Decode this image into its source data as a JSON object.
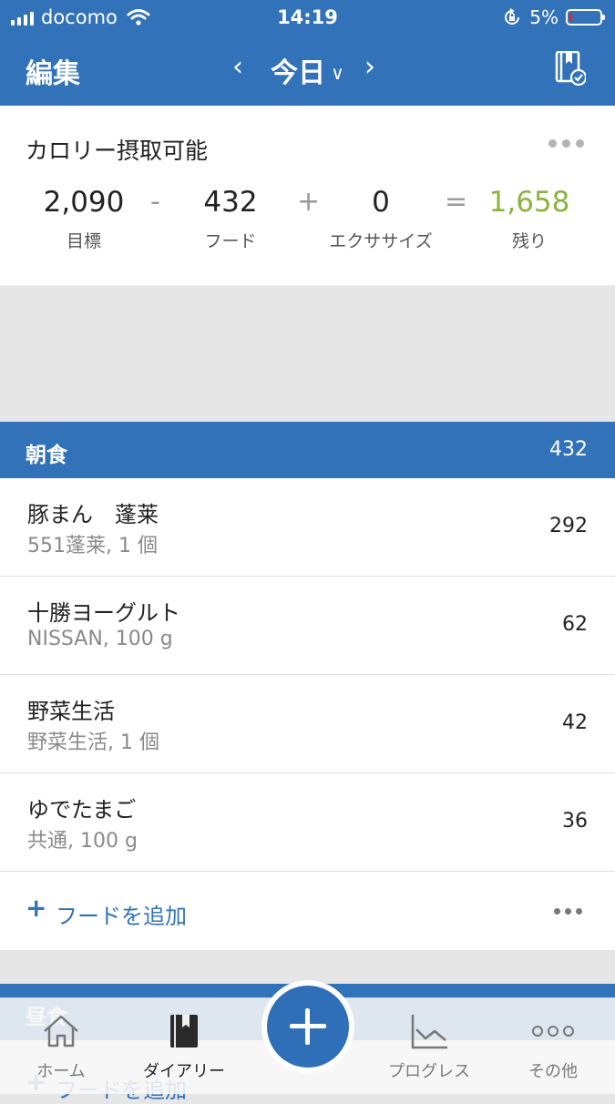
{
  "status_bar": {
    "carrier": "docomo",
    "time": "14:19",
    "battery": "5%"
  },
  "nav": {
    "edit_label": "編集",
    "date_label": "今日",
    "prev": "‹",
    "next": "›",
    "chevron": "∨"
  },
  "calories": {
    "title": "カロリー摂取可能",
    "goal_value": "2,090",
    "goal_label": "目標",
    "minus": "-",
    "food_value": "432",
    "food_label": "フード",
    "plus": "+",
    "exercise_value": "0",
    "exercise_label": "エクササイズ",
    "equals": "=",
    "remaining_value": "1,658",
    "remaining_label": "残り",
    "remaining_color": "#8cb33f"
  },
  "breakfast": {
    "name": "朝食",
    "total": "432",
    "items": [
      {
        "name": "豚まん　蓬莱",
        "desc": "551蓬莱, 1 個",
        "cal": "292"
      },
      {
        "name": "十勝ヨーグルト",
        "desc": "NISSAN, 100 g",
        "cal": "62"
      },
      {
        "name": "野菜生活",
        "desc": "野菜生活, 1 個",
        "cal": "42"
      },
      {
        "name": "ゆでたまご",
        "desc": "共通, 100 g",
        "cal": "36"
      }
    ],
    "add_plus": "+",
    "add_label": "フードを追加"
  },
  "lunch": {
    "name": "昼食",
    "add_label": "フードを追加"
  },
  "tabs": [
    {
      "label": "ホーム",
      "icon": "home-icon"
    },
    {
      "label": "ダイアリー",
      "icon": "diary-icon"
    },
    {
      "label": "プログレス",
      "icon": "progress-icon"
    },
    {
      "label": "その他",
      "icon": "more-icon"
    }
  ],
  "colors": {
    "brand_blue": "#3272b8",
    "fab_blue": "#2f6fb8"
  }
}
